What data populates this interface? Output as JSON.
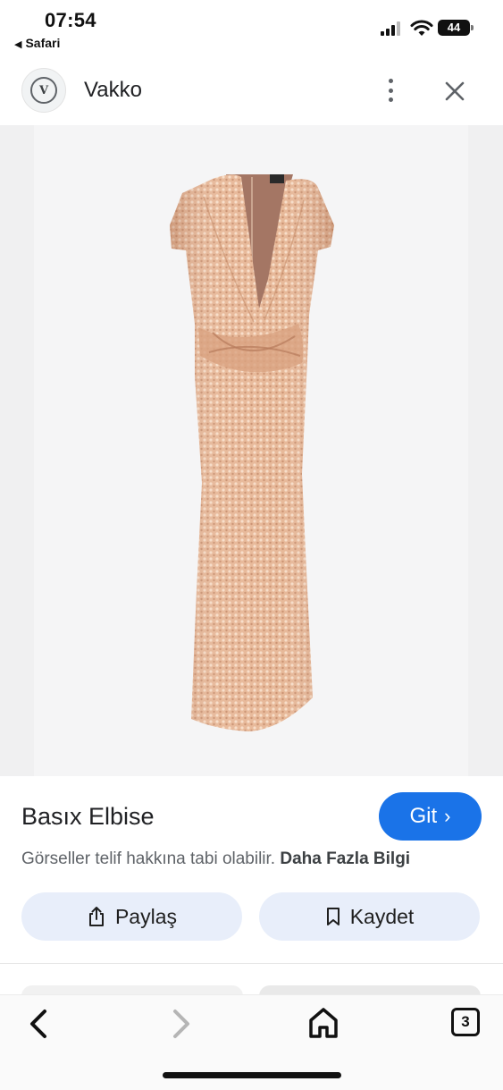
{
  "status_bar": {
    "time": "07:54",
    "back_app": "Safari",
    "battery": "44"
  },
  "header": {
    "logo_text": "V",
    "site_name": "Vakko",
    "more_icon": "more-vert-icon",
    "close_icon": "close-icon"
  },
  "product": {
    "title": "Basıx Elbise",
    "visit_label": "Git",
    "copyright_text": "Görseller telif hakkına tabi olabilir.",
    "more_info_label": "Daha Fazla Bilgi"
  },
  "actions": {
    "share_label": "Paylaş",
    "save_label": "Kaydet"
  },
  "bottom_bar": {
    "tab_count": "3"
  },
  "colors": {
    "accent": "#1a73e8",
    "action_bg": "#e8eefa",
    "dress": "#e8b898"
  }
}
